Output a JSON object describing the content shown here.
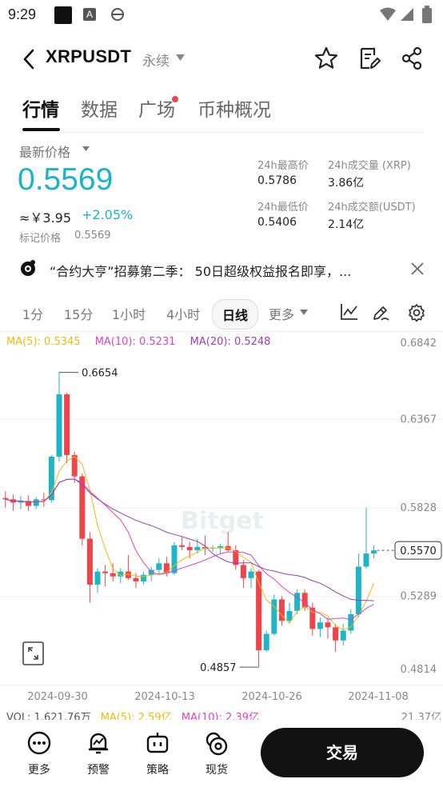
{
  "status_bar": {
    "time": "9:29"
  },
  "header": {
    "symbol": "XRPUSDT",
    "contract_type": "永续"
  },
  "tabs": [
    {
      "label": "行情",
      "active": true
    },
    {
      "label": "数据",
      "active": false
    },
    {
      "label": "广场",
      "active": false,
      "badge": true
    },
    {
      "label": "币种概况",
      "active": false
    }
  ],
  "price": {
    "label": "最新价格",
    "last": "0.5569",
    "cny": "≈￥3.95",
    "change": "+2.05%",
    "mark_label": "标记价格",
    "mark_value": "0.5569"
  },
  "stats": {
    "high_label": "24h最高价",
    "high": "0.5786",
    "low_label": "24h最低价",
    "low": "0.5406",
    "vol_label": "24h成交量 (XRP)",
    "vol": "3.86亿",
    "amount_label": "24h成交额(USDT)",
    "amount": "2.14亿"
  },
  "notice": {
    "text": "“合约大亨”招募第二季： 50日超级权益报名即享，..."
  },
  "timeframes": [
    {
      "label": "1分",
      "active": false
    },
    {
      "label": "15分",
      "active": false
    },
    {
      "label": "1小时",
      "active": false
    },
    {
      "label": "4小时",
      "active": false
    },
    {
      "label": "日线",
      "active": true
    }
  ],
  "more_label": "更多",
  "chart_data": {
    "type": "candlestick",
    "ma": [
      {
        "name": "MA(5)",
        "value": "0.5345",
        "color": "#f0b90b"
      },
      {
        "name": "MA(10)",
        "value": "0.5231",
        "color": "#e040c8"
      },
      {
        "name": "MA(20)",
        "value": "0.5248",
        "color": "#9c3cb4"
      }
    ],
    "y_ticks": [
      "0.6842",
      "0.6367",
      "0.5828",
      "0.5289",
      "0.4814"
    ],
    "y_tick_values": [
      0.6842,
      0.6367,
      0.5828,
      0.5289,
      0.4814
    ],
    "x_ticks": [
      "2024-09-30",
      "2024-10-13",
      "2024-10-26",
      "2024-11-08"
    ],
    "ylim": [
      0.4814,
      0.6842
    ],
    "high_label": "0.6654",
    "low_label": "0.4857",
    "current_price_label": "0.5570",
    "watermark": "Bitget",
    "up_color": "#1fb5c5",
    "down_color": "#f0444b",
    "candles": [
      [
        0.5888,
        0.593,
        0.583,
        0.588
      ],
      [
        0.588,
        0.591,
        0.581,
        0.586
      ],
      [
        0.586,
        0.59,
        0.582,
        0.587
      ],
      [
        0.587,
        0.5905,
        0.581,
        0.584
      ],
      [
        0.584,
        0.5895,
        0.582,
        0.588
      ],
      [
        0.588,
        0.592,
        0.5835,
        0.5875
      ],
      [
        0.5875,
        0.615,
        0.586,
        0.614
      ],
      [
        0.614,
        0.6654,
        0.611,
        0.652
      ],
      [
        0.652,
        0.653,
        0.61,
        0.615
      ],
      [
        0.615,
        0.617,
        0.598,
        0.602
      ],
      [
        0.602,
        0.604,
        0.56,
        0.564
      ],
      [
        0.564,
        0.568,
        0.525,
        0.536
      ],
      [
        0.536,
        0.546,
        0.531,
        0.544
      ],
      [
        0.544,
        0.548,
        0.535,
        0.543
      ],
      [
        0.543,
        0.549,
        0.538,
        0.541
      ],
      [
        0.541,
        0.546,
        0.537,
        0.544
      ],
      [
        0.544,
        0.554,
        0.539,
        0.54
      ],
      [
        0.54,
        0.543,
        0.534,
        0.538
      ],
      [
        0.538,
        0.544,
        0.536,
        0.542
      ],
      [
        0.542,
        0.547,
        0.538,
        0.545
      ],
      [
        0.545,
        0.552,
        0.542,
        0.549
      ],
      [
        0.549,
        0.553,
        0.541,
        0.543
      ],
      [
        0.543,
        0.562,
        0.542,
        0.56
      ],
      [
        0.56,
        0.565,
        0.557,
        0.559
      ],
      [
        0.559,
        0.562,
        0.552,
        0.557
      ],
      [
        0.557,
        0.564,
        0.555,
        0.559
      ],
      [
        0.559,
        0.566,
        0.554,
        0.558
      ],
      [
        0.558,
        0.56,
        0.556,
        0.5585
      ],
      [
        0.5585,
        0.561,
        0.555,
        0.5595
      ],
      [
        0.5595,
        0.568,
        0.556,
        0.557
      ],
      [
        0.557,
        0.56,
        0.545,
        0.548
      ],
      [
        0.548,
        0.551,
        0.534,
        0.54
      ],
      [
        0.54,
        0.546,
        0.534,
        0.544
      ],
      [
        0.544,
        0.545,
        0.4857,
        0.496
      ],
      [
        0.496,
        0.508,
        0.495,
        0.506
      ],
      [
        0.506,
        0.53,
        0.505,
        0.527
      ],
      [
        0.527,
        0.529,
        0.511,
        0.514
      ],
      [
        0.514,
        0.525,
        0.512,
        0.52
      ],
      [
        0.52,
        0.533,
        0.518,
        0.531
      ],
      [
        0.531,
        0.533,
        0.52,
        0.522
      ],
      [
        0.522,
        0.525,
        0.505,
        0.509
      ],
      [
        0.509,
        0.516,
        0.504,
        0.513
      ],
      [
        0.513,
        0.516,
        0.503,
        0.51
      ],
      [
        0.51,
        0.512,
        0.495,
        0.502
      ],
      [
        0.502,
        0.512,
        0.499,
        0.508
      ],
      [
        0.508,
        0.521,
        0.506,
        0.518
      ],
      [
        0.518,
        0.555,
        0.516,
        0.547
      ],
      [
        0.547,
        0.583,
        0.546,
        0.555
      ],
      [
        0.555,
        0.56,
        0.552,
        0.5569
      ]
    ]
  },
  "volume": {
    "label": "VOL: 1,621.76万",
    "ma5": "MA(5): 2.59亿",
    "ma10": "MA(10): 2.39亿",
    "right": "21.37亿"
  },
  "bottom_nav": [
    {
      "label": "更多",
      "icon": "more-icon"
    },
    {
      "label": "预警",
      "icon": "alert-bell-icon"
    },
    {
      "label": "策略",
      "icon": "robot-icon"
    },
    {
      "label": "现货",
      "icon": "spot-icon"
    }
  ],
  "trade_button": {
    "label": "交易"
  }
}
